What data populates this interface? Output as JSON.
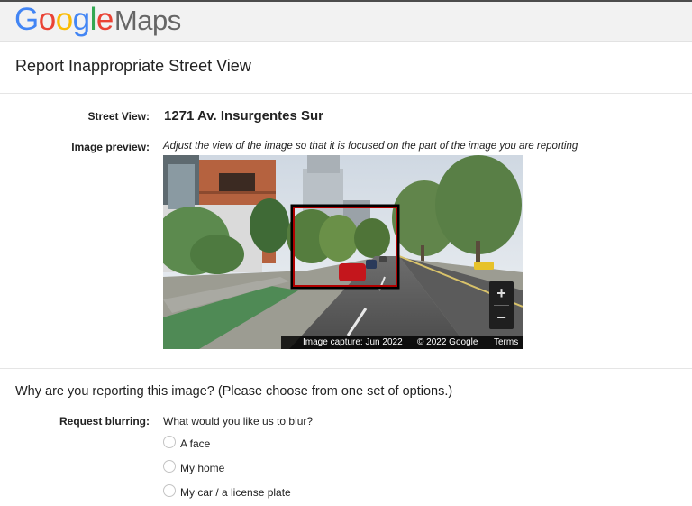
{
  "logo": {
    "letters": [
      "G",
      "o",
      "o",
      "g",
      "l",
      "e"
    ],
    "product": "Maps"
  },
  "page": {
    "title": "Report Inappropriate Street View"
  },
  "street_view": {
    "label": "Street View:",
    "value": "1271 Av. Insurgentes Sur"
  },
  "image_preview": {
    "label": "Image preview:",
    "hint": "Adjust the view of the image so that it is focused on the part of the image you are reporting",
    "zoom_in": "+",
    "zoom_out": "−",
    "capture_date": "Image capture: Jun 2022",
    "copyright": "© 2022 Google",
    "terms": "Terms"
  },
  "reason": {
    "heading": "Why are you reporting this image?  (Please choose from one set of options.)"
  },
  "blurring": {
    "label": "Request blurring:",
    "question": "What would you like us to blur?",
    "options": [
      "A face",
      "My home",
      "My car / a license plate"
    ]
  }
}
